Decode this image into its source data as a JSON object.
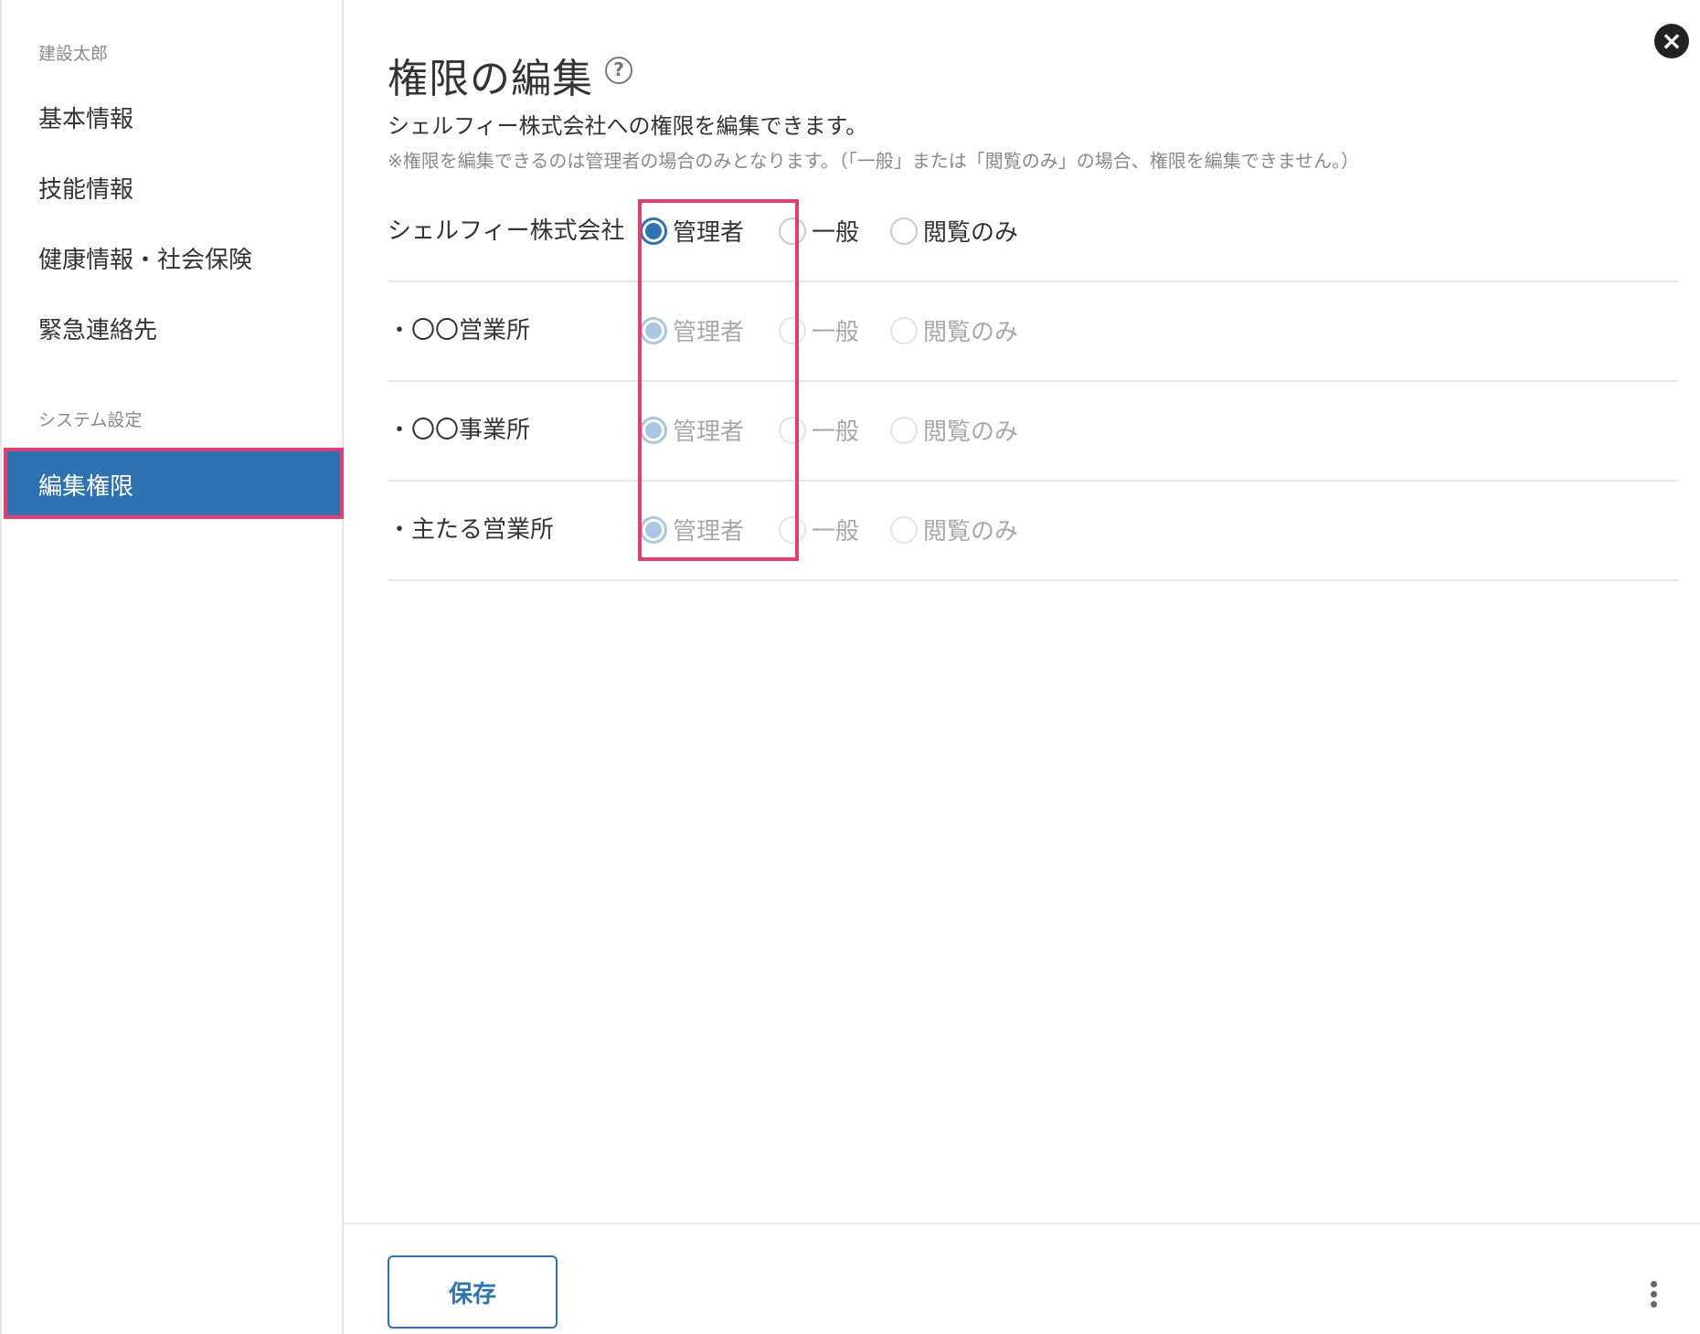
{
  "sidebar": {
    "user_section_label": "建設太郎",
    "items": [
      {
        "label": "基本情報"
      },
      {
        "label": "技能情報"
      },
      {
        "label": "健康情報・社会保険"
      },
      {
        "label": "緊急連絡先"
      }
    ],
    "system_section_label": "システム設定",
    "active_item": {
      "label": "編集権限"
    }
  },
  "main": {
    "title": "権限の編集",
    "help_icon": "?",
    "description": "シェルフィー株式会社への権限を編集できます。",
    "note": "※権限を編集できるのは管理者の場合のみとなります。（「一般」または「閲覧のみ」の場合、権限を編集できません。）",
    "close_icon": "×",
    "options": {
      "admin": "管理者",
      "general": "一般",
      "view_only": "閲覧のみ"
    },
    "rows": [
      {
        "name": "シェルフィー株式会社",
        "selected": "admin",
        "disabled": false
      },
      {
        "name": "・〇〇営業所",
        "selected": "admin",
        "disabled": true
      },
      {
        "name": "・〇〇事業所",
        "selected": "admin",
        "disabled": true
      },
      {
        "name": "・主たる営業所",
        "selected": "admin",
        "disabled": true
      }
    ]
  },
  "footer": {
    "save_label": "保存"
  },
  "colors": {
    "accent": "#2d73b4",
    "highlight": "#e63d6e"
  }
}
